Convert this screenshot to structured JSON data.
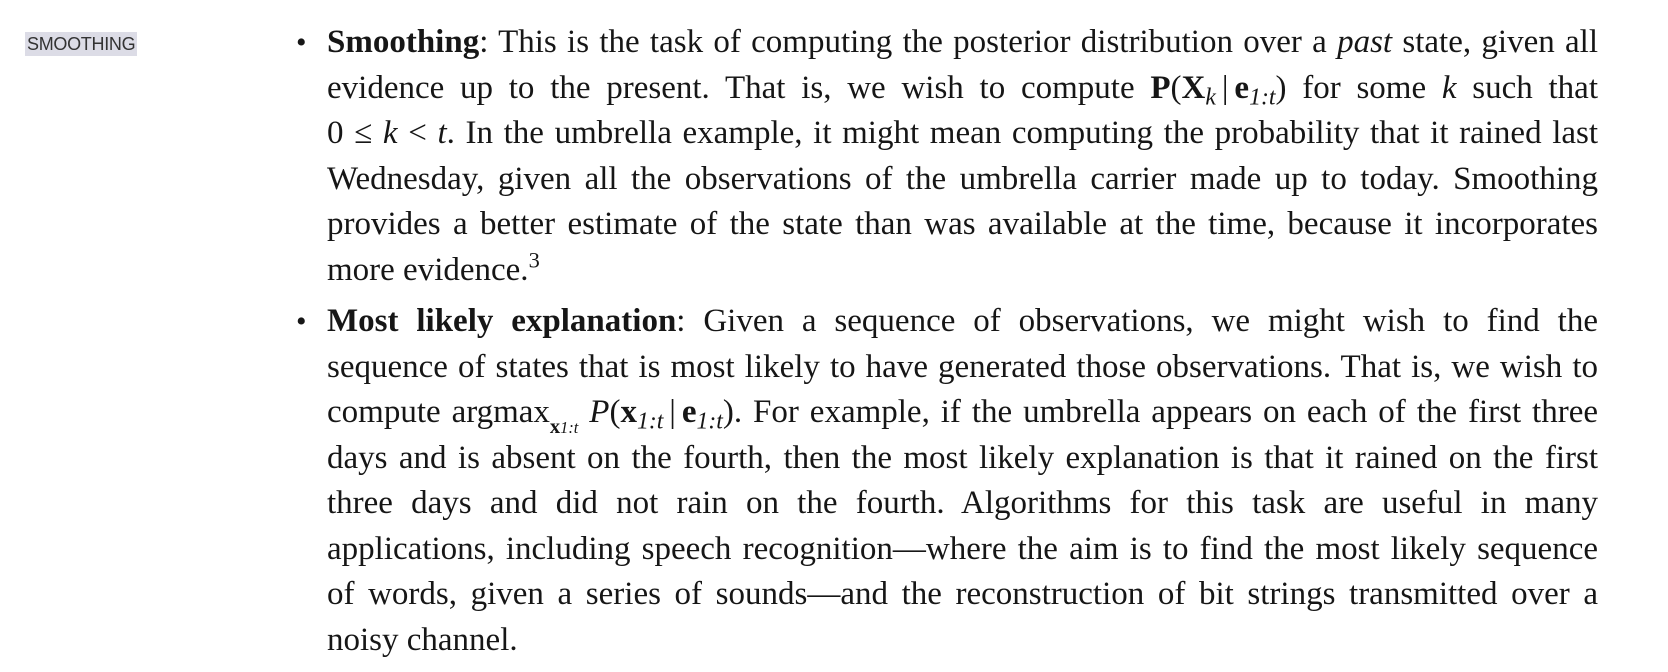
{
  "margin_note": "SMOOTHING",
  "items": [
    {
      "term": "Smoothing",
      "seg1": ": This is the task of computing the posterior distribution over a ",
      "emph": "past",
      "seg2": " state, given all evidence up to the present. That is, we wish to compute ",
      "seg3": " for some ",
      "var_k": "k",
      "seg4": " such that ",
      "seg5": ". In the umbrella example, it might mean computing the probability that it rained last Wednesday, given all the observations of the umbrella carrier made up to today. Smoothing provides a better estimate of the state than was available at the time, because it incorporates more evidence.",
      "footnote": "3",
      "formula_P": "P",
      "formula_X": "X",
      "formula_k": "k",
      "formula_e": "e",
      "formula_range": "1:t",
      "ineq_0": "0",
      "ineq_le": "≤",
      "ineq_k": "k",
      "ineq_lt": "<",
      "ineq_t": "t"
    },
    {
      "term": "Most likely explanation",
      "seg1": ": Given a sequence of observations, we might wish to find the sequence of states that is most likely to have generated those observations. That is, we wish to compute ",
      "argmax": "argmax",
      "argmax_sub_x": "x",
      "argmax_sub_range": "1:t",
      "formula_P": "P",
      "formula_x": "x",
      "formula_range": "1:t",
      "formula_e": "e",
      "formula_range2": "1:t",
      "seg2": ". For example, if the umbrella appears on each of the first three days and is absent on the fourth, then the most likely explanation is that it rained on the first three days and did not rain on the fourth. Algorithms for this task are useful in many applications, including speech recognition—where the aim is to find the most likely sequence of words, given a series of sounds—and the reconstruction of bit strings transmitted over a noisy channel."
    }
  ],
  "bullet_glyph": "•"
}
